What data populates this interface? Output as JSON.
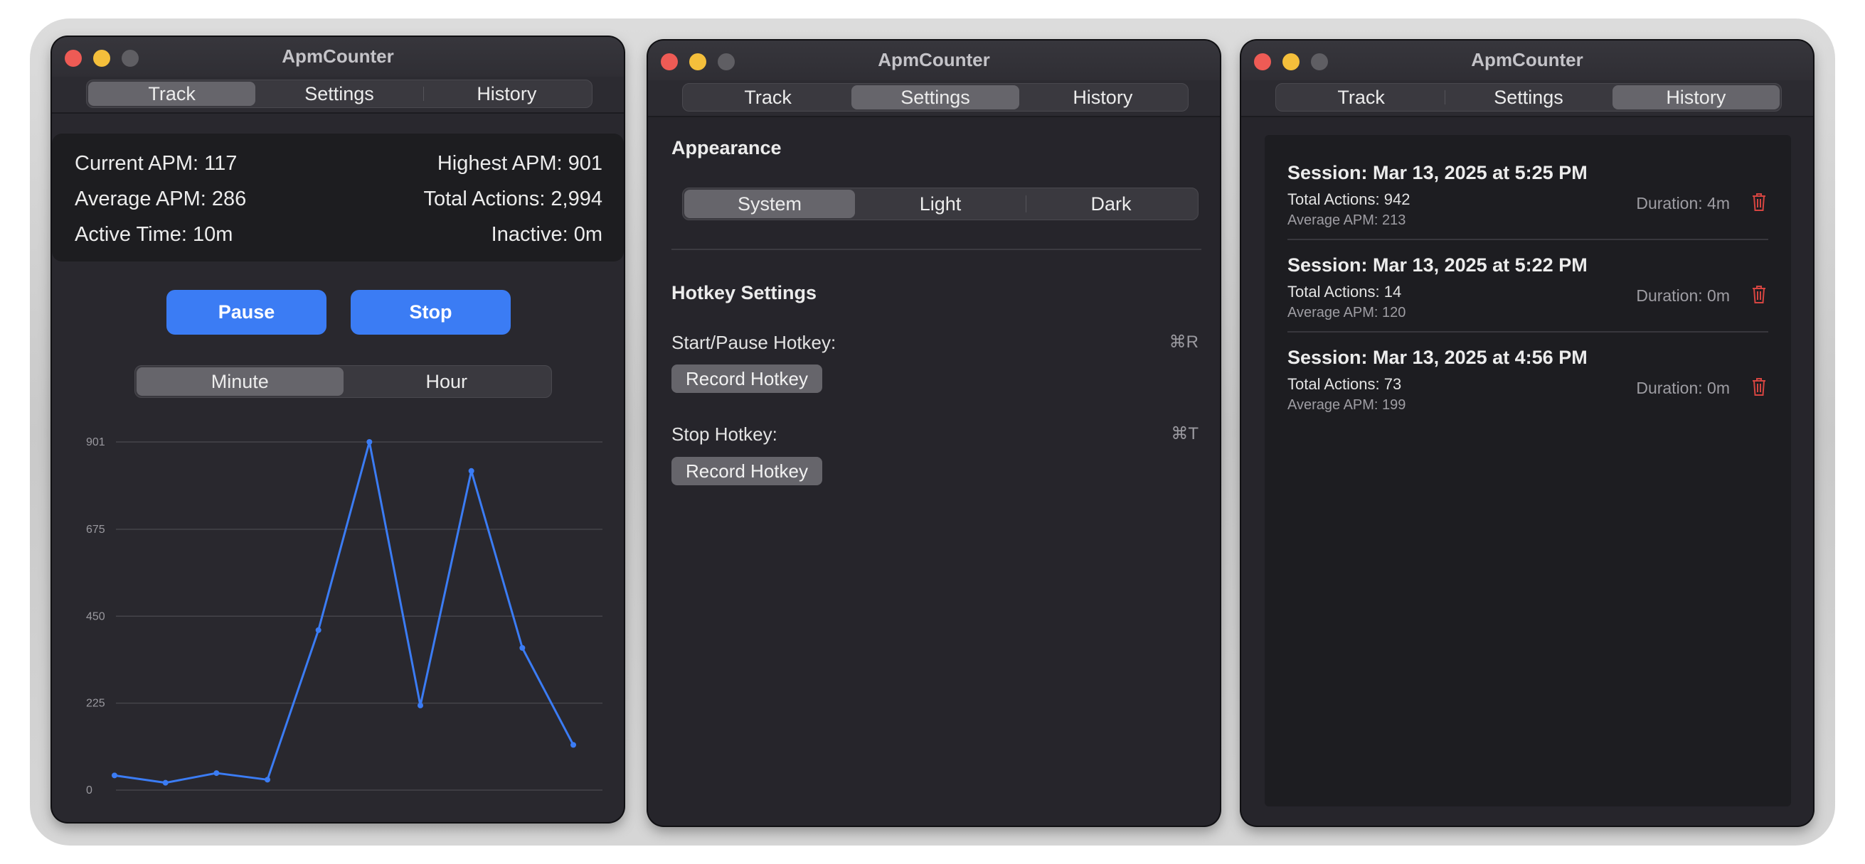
{
  "app": {
    "title": "ApmCounter"
  },
  "tabs": [
    "Track",
    "Settings",
    "History"
  ],
  "track": {
    "current_apm": "Current APM: 117",
    "highest_apm": "Highest APM: 901",
    "average_apm": "Average APM: 286",
    "total_actions": "Total Actions: 2,994",
    "active_time": "Active Time: 10m",
    "inactive": "Inactive: 0m",
    "pause_label": "Pause",
    "stop_label": "Stop",
    "range_options": [
      "Minute",
      "Hour"
    ],
    "range_selected": "Minute"
  },
  "chart_data": {
    "type": "line",
    "title": "",
    "xlabel": "",
    "ylabel": "",
    "ylim": [
      0,
      901
    ],
    "yticks": [
      0,
      225,
      450,
      675,
      901
    ],
    "grid": true,
    "color": "#3b7cf4",
    "x": [
      1,
      2,
      3,
      4,
      5,
      6,
      7,
      8,
      9,
      10
    ],
    "values": [
      38,
      19,
      44,
      27,
      414,
      901,
      219,
      826,
      368,
      117
    ]
  },
  "settings": {
    "appearance_title": "Appearance",
    "appearance_options": [
      "System",
      "Light",
      "Dark"
    ],
    "appearance_selected": "System",
    "hotkey_title": "Hotkey Settings",
    "start_pause_label": "Start/Pause Hotkey:",
    "start_pause_key": "⌘R",
    "stop_label": "Stop Hotkey:",
    "stop_key": "⌘T",
    "record_label": "Record Hotkey"
  },
  "history": {
    "sessions": [
      {
        "title": "Session: Mar 13, 2025 at 5:25 PM",
        "total": "Total Actions: 942",
        "avg": "Average APM: 213",
        "duration": "Duration: 4m"
      },
      {
        "title": "Session: Mar 13, 2025 at 5:22 PM",
        "total": "Total Actions: 14",
        "avg": "Average APM: 120",
        "duration": "Duration: 0m"
      },
      {
        "title": "Session: Mar 13, 2025 at 4:56 PM",
        "total": "Total Actions: 73",
        "avg": "Average APM: 199",
        "duration": "Duration: 0m"
      }
    ],
    "delete_color": "#d64541"
  },
  "colors": {
    "accent": "#3b7cf4",
    "close": "#ee5b55",
    "minimize": "#f4bf3b",
    "window_bg": "#26252b"
  }
}
